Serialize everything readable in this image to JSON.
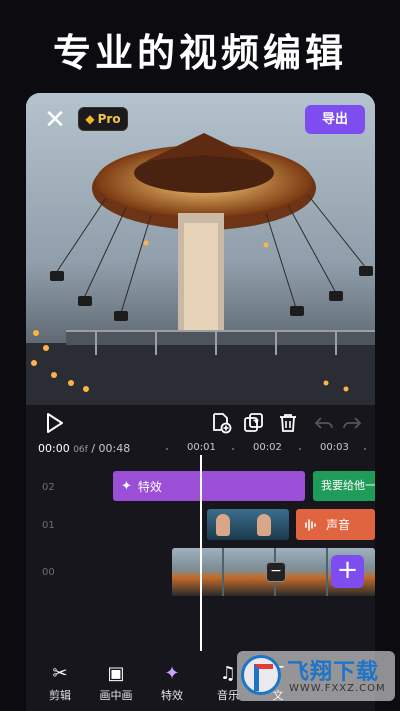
{
  "headline": "专业的视频编辑",
  "top_bar": {
    "pro_label": "Pro",
    "export_label": "导出"
  },
  "colors": {
    "accent": "#7e4df0",
    "effect_clip": "#9a4fd6",
    "text_clip": "#1f9c5a",
    "audio_clip": "#e0643f",
    "pro_gold": "#f3c34a"
  },
  "toolbar": {
    "icons": [
      "play-icon",
      "add-frame-icon",
      "copy-icon",
      "delete-icon",
      "undo-icon",
      "redo-icon"
    ]
  },
  "timeline": {
    "current_time": "00:00",
    "current_frame": "06f",
    "separator": "/",
    "total_time": "00:48",
    "ruler_ticks": [
      "00:01",
      "00:02",
      "00:03"
    ],
    "track_labels": [
      "02",
      "01",
      "00"
    ],
    "clips": {
      "effect_label": "特效",
      "text_label": "我要给他一",
      "audio_label": "声音"
    }
  },
  "bottom_nav": {
    "items": [
      {
        "label": "剪辑",
        "icon": "scissors-icon"
      },
      {
        "label": "画中画",
        "icon": "picture-in-picture-icon"
      },
      {
        "label": "特效",
        "icon": "sparkle-icon"
      },
      {
        "label": "音乐",
        "icon": "music-note-icon"
      },
      {
        "label": "文",
        "icon": "text-icon"
      }
    ]
  },
  "watermark": {
    "title": "飞翔下载",
    "url": "WWW.FXXZ.COM"
  }
}
